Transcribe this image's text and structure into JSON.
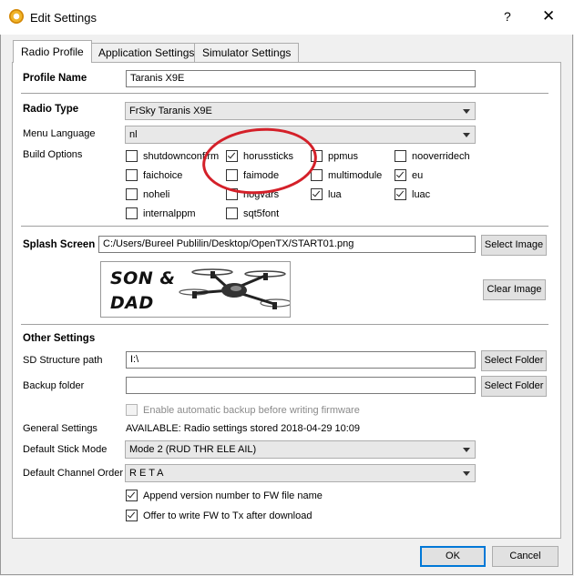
{
  "window": {
    "title": "Edit Settings",
    "help_glyph": "?",
    "close_glyph": "✕"
  },
  "tabs": [
    {
      "label": "Radio Profile",
      "active": true
    },
    {
      "label": "Application Settings",
      "active": false
    },
    {
      "label": "Simulator Settings",
      "active": false
    }
  ],
  "profile": {
    "name_label": "Profile Name",
    "name_value": "Taranis X9E"
  },
  "radio": {
    "type_label": "Radio Type",
    "type_value": "FrSky Taranis X9E",
    "menu_language_label": "Menu Language",
    "menu_language_value": "nl",
    "build_options_label": "Build Options",
    "build_options": [
      {
        "label": "shutdownconfirm",
        "checked": false
      },
      {
        "label": "horussticks",
        "checked": true
      },
      {
        "label": "ppmus",
        "checked": false
      },
      {
        "label": "nooverridech",
        "checked": false
      },
      {
        "label": "faichoice",
        "checked": false
      },
      {
        "label": "faimode",
        "checked": false
      },
      {
        "label": "multimodule",
        "checked": false
      },
      {
        "label": "eu",
        "checked": true
      },
      {
        "label": "noheli",
        "checked": false
      },
      {
        "label": "nogvars",
        "checked": false
      },
      {
        "label": "lua",
        "checked": true
      },
      {
        "label": "luac",
        "checked": true
      },
      {
        "label": "internalppm",
        "checked": false
      },
      {
        "label": "sqt5font",
        "checked": false
      }
    ]
  },
  "splash": {
    "label": "Splash Screen",
    "path": "C:/Users/Bureel Publilin/Desktop/OpenTX/START01.png",
    "select_button": "Select Image",
    "clear_button": "Clear Image",
    "preview_line1": "SON &",
    "preview_line2": "DAD"
  },
  "other": {
    "heading": "Other Settings",
    "sd_label": "SD Structure path",
    "sd_value": "I:\\",
    "sd_button": "Select Folder",
    "backup_label": "Backup folder",
    "backup_value": "",
    "backup_button": "Select Folder",
    "auto_backup_label": "Enable automatic backup before writing firmware",
    "auto_backup_checked": false,
    "general_label": "General Settings",
    "general_value": "AVAILABLE: Radio settings stored 2018-04-29 10:09",
    "stick_mode_label": "Default Stick Mode",
    "stick_mode_value": "Mode 2 (RUD THR ELE AIL)",
    "channel_order_label": "Default Channel Order",
    "channel_order_value": "R E T A",
    "append_version_label": "Append version number to FW file name",
    "append_version_checked": true,
    "offer_write_label": "Offer to write FW to Tx after download",
    "offer_write_checked": true
  },
  "buttons": {
    "ok": "OK",
    "cancel": "Cancel"
  },
  "colors": {
    "annotation_circle": "#d42029",
    "default_button_border": "#0078d7"
  }
}
